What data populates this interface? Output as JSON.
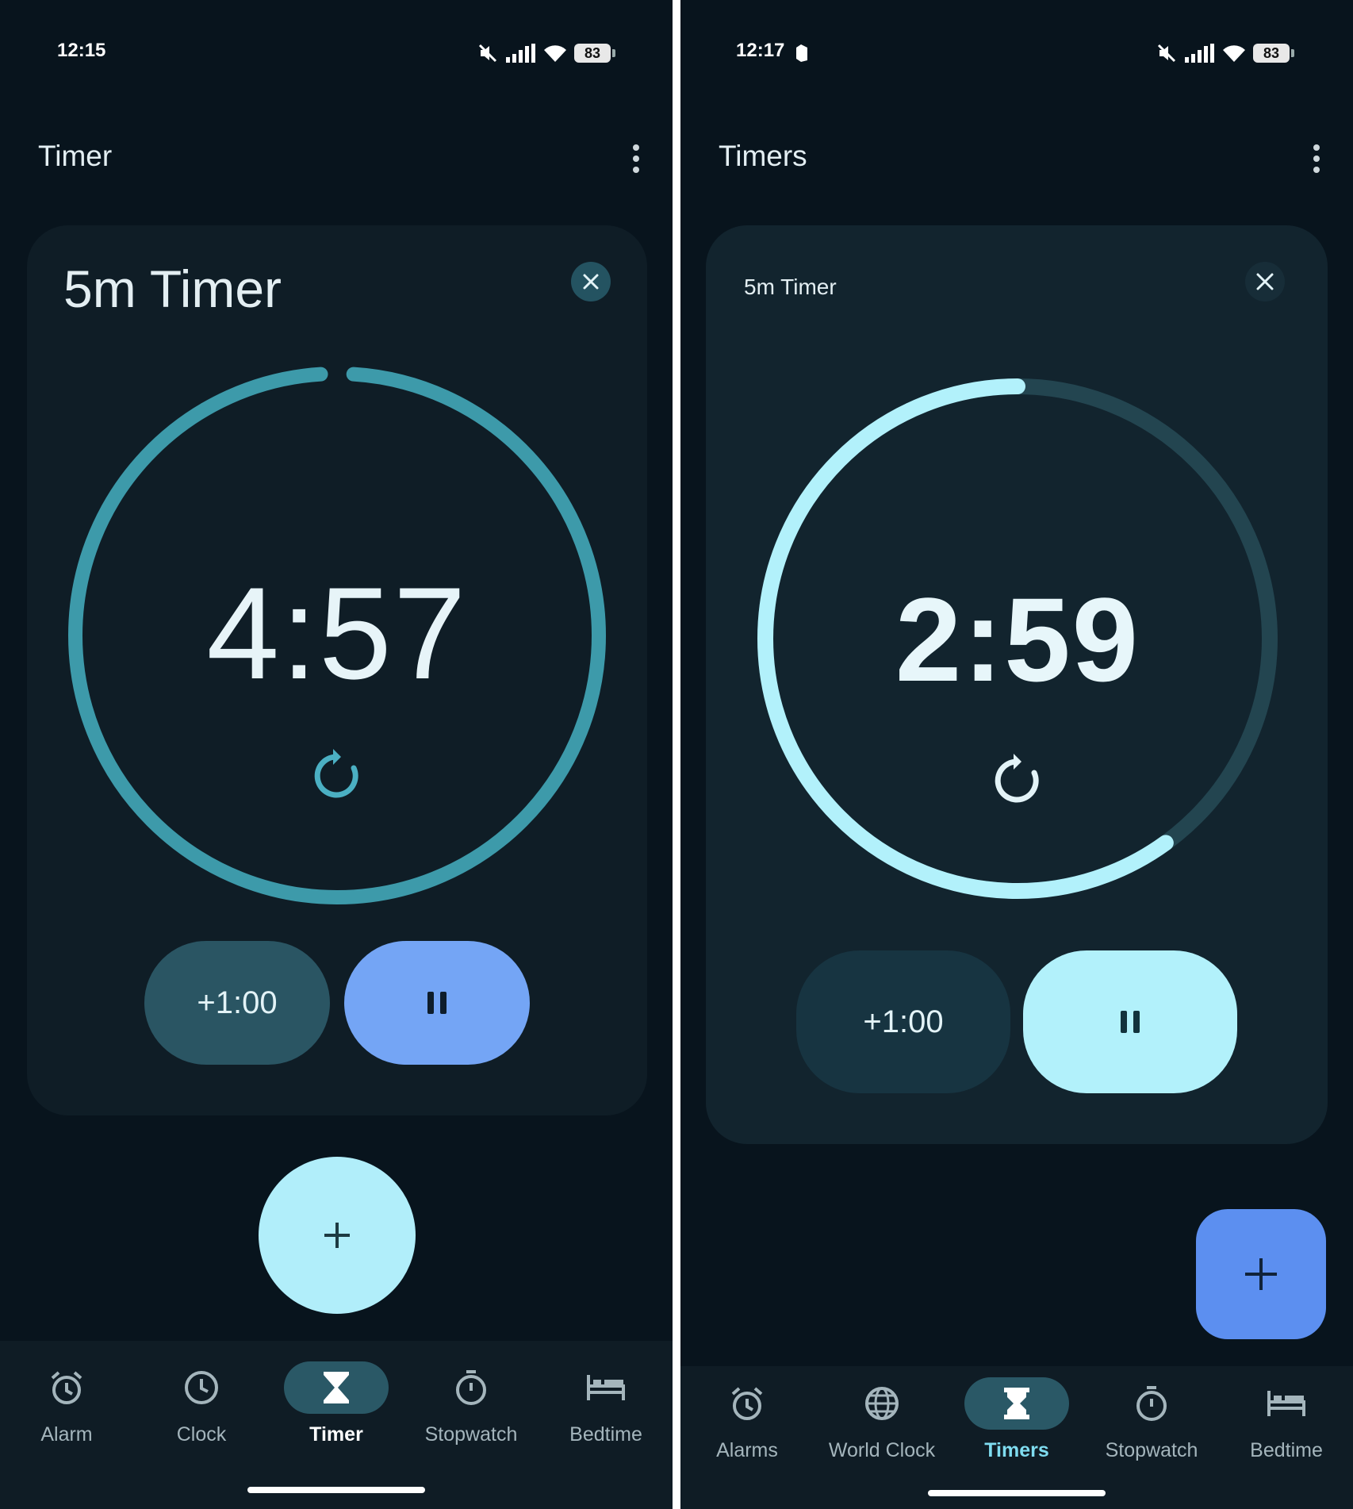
{
  "left": {
    "status_time": "12:15",
    "battery": "83",
    "app_title": "Timer",
    "timer": {
      "label": "5m Timer",
      "remaining": "4:57",
      "add_time": "+1:00",
      "progress_remaining_fraction": 0.99
    },
    "nav": [
      {
        "label": "Alarm",
        "icon": "alarm-icon"
      },
      {
        "label": "Clock",
        "icon": "clock-icon"
      },
      {
        "label": "Timer",
        "icon": "hourglass-icon",
        "active": true
      },
      {
        "label": "Stopwatch",
        "icon": "stopwatch-icon"
      },
      {
        "label": "Bedtime",
        "icon": "bed-icon"
      }
    ],
    "colors": {
      "ring": "#3d9aaa",
      "pause_button": "#74a5f5",
      "add_button": "#2a5563",
      "fab": "#b1eefa"
    }
  },
  "right": {
    "status_time": "12:17",
    "battery": "83",
    "app_title": "Timers",
    "timer": {
      "label": "5m Timer",
      "remaining": "2:59",
      "add_time": "+1:00",
      "progress_remaining_fraction": 0.6
    },
    "nav": [
      {
        "label": "Alarms",
        "icon": "alarm-icon"
      },
      {
        "label": "World Clock",
        "icon": "globe-icon"
      },
      {
        "label": "Timers",
        "icon": "hourglass-icon",
        "active": true
      },
      {
        "label": "Stopwatch",
        "icon": "stopwatch-icon"
      },
      {
        "label": "Bedtime",
        "icon": "bed-icon"
      }
    ],
    "colors": {
      "ring": "#b2f1fb",
      "ring_track": "#234550",
      "pause_button": "#b2f1fb",
      "add_button": "#173441",
      "fab": "#5c8ff0"
    }
  }
}
